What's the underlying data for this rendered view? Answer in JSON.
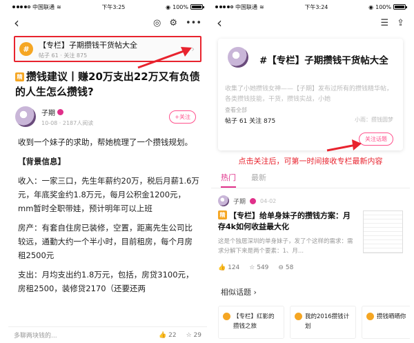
{
  "left_screen": {
    "status": {
      "carrier": "中国联通",
      "time": "下午3:25",
      "battery": "100%"
    },
    "nav": {
      "back": "‹",
      "icon_chat": "◎",
      "icon_settings": "⚙",
      "icon_more": "•••"
    },
    "topic_card": {
      "icon": "#",
      "title": "【专栏】子期攒钱干货帖大全",
      "meta": "帖子 61 · 关注 875",
      "chevron": "›"
    },
    "article": {
      "tag": "精",
      "title": "攒钱建议丨赚20万支出22万又有负债的人生怎么攒钱?",
      "author": "子期",
      "author_meta": "10-08 · 2187人阅读",
      "follow_label": "+关注",
      "paragraphs": [
        "收到一个妹子的求助，帮她梳理了一个攒钱规划。",
        "【背景信息】",
        "收入：一家三口，先生年薪约20万，税后月薪1.6万元，年底奖金约1.8万元，每月公积金1200元，mm暂时全职带娃，预计明年可以上班",
        "房产：有套自住房已装修，空置，距离先生公司比较远，通勤大约一个半小时，目前租房，每个月房租2500元",
        "支出：月均支出约1.8万元，包括，房贷3100元，房租2500，装修贷2170（还要还两"
      ]
    },
    "bottom_bar": {
      "placeholder": "多聊两块钱的...",
      "likes": "22",
      "stars": "29"
    }
  },
  "right_screen": {
    "status": {
      "carrier": "中国联通",
      "time": "下午3:24",
      "battery": "100%"
    },
    "nav": {
      "back": "‹",
      "icon_list": "☰",
      "icon_share": "⇪"
    },
    "topic_header": {
      "title": "#【专栏】子期攒钱干货帖大全",
      "description": "收集了小她攒钱女神——【子期】发布过所有的攒钱精华帖，各类攒钱技能，干货，攒钱实战，小她",
      "view_all": "查看全部",
      "stats": "帖子 61  关注 875",
      "owner": "小雨：攒钱圆梦",
      "follow_topic": "关注话题"
    },
    "promo": "点击关注后，可第一时间接收专栏最新内容",
    "tabs": [
      {
        "label": "热门"
      },
      {
        "label": "最新"
      }
    ],
    "post": {
      "author": "子期",
      "date": "04-02",
      "tag": "精",
      "title": "【专栏】给单身妹子的攒钱方案：月存4k如何收益最大化",
      "desc": "这是个独居深圳的单身妹子，发了个这样的需求：需求分解下来是两个要素：1、月...",
      "likes": "124",
      "stars": "549",
      "comments": "58"
    },
    "similar": {
      "header": "相似话题",
      "chevron": "›",
      "items": [
        {
          "label": "【专栏】红影的攒钱之旅"
        },
        {
          "label": "我的2016攒钱计划"
        },
        {
          "label": "攒钱晒晒你"
        }
      ]
    }
  },
  "colors": {
    "accent_red": "#e8232e",
    "accent_pink": "#e0308a",
    "tag_orange": "#f5a623"
  }
}
